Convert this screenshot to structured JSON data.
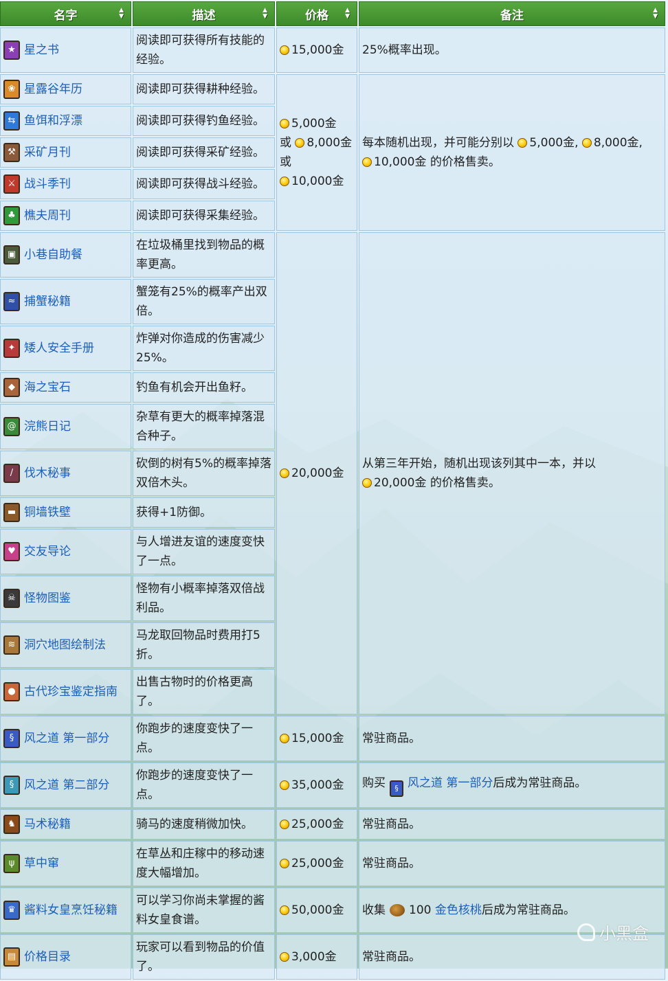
{
  "headers": [
    "名字",
    "描述",
    "价格",
    "备注"
  ],
  "colors": {
    "header_green": "#3f8d2f",
    "link_blue": "#1d5fb8",
    "coin_gold": "#ffd31a"
  },
  "rows": [
    {
      "name": "星之书",
      "icon": "book-star-icon",
      "color": "#8b3fb5",
      "glyph": "★",
      "desc": "阅读即可获得所有技能的经验。",
      "price": "15,000金",
      "note": "25%概率出现。"
    },
    {
      "name": "星露谷年历",
      "icon": "book-almanac-icon",
      "color": "#d98a2a",
      "glyph": "❀",
      "desc": "阅读即可获得耕种经验。"
    },
    {
      "name": "鱼饵和浮漂",
      "icon": "book-bait-icon",
      "color": "#2f7ad9",
      "glyph": "⇆",
      "desc": "阅读即可获得钓鱼经验。"
    },
    {
      "name": "采矿月刊",
      "icon": "book-mining-icon",
      "color": "#8a5a3a",
      "glyph": "⚒",
      "desc": "阅读即可获得采矿经验。"
    },
    {
      "name": "战斗季刊",
      "icon": "book-combat-icon",
      "color": "#c0392b",
      "glyph": "⚔",
      "desc": "阅读即可获得战斗经验。"
    },
    {
      "name": "樵夫周刊",
      "icon": "book-woodcutter-icon",
      "color": "#2e9a3a",
      "glyph": "♣",
      "desc": "阅读即可获得采集经验。"
    },
    {
      "name": "小巷自助餐",
      "icon": "book-trash-icon",
      "color": "#4a5a3a",
      "glyph": "▣",
      "desc": "在垃圾桶里找到物品的概率更高。"
    },
    {
      "name": "捕蟹秘籍",
      "icon": "book-crab-icon",
      "color": "#3050a8",
      "glyph": "≈",
      "desc": "蟹笼有25%的概率产出双倍。"
    },
    {
      "name": "矮人安全手册",
      "icon": "book-dwarf-icon",
      "color": "#b83a3a",
      "glyph": "✦",
      "desc": "炸弹对你造成的伤害减少25%。"
    },
    {
      "name": "海之宝石",
      "icon": "book-jewels-icon",
      "color": "#a8643a",
      "glyph": "◆",
      "desc": "钓鱼有机会开出鱼籽。"
    },
    {
      "name": "浣熊日记",
      "icon": "book-raccoon-icon",
      "color": "#3a8a3a",
      "glyph": "@",
      "desc": "杂草有更大的概率掉落混合种子。"
    },
    {
      "name": "伐木秘事",
      "icon": "book-lumber-icon",
      "color": "#7a3a4a",
      "glyph": "/",
      "desc": "砍倒的树有5%的概率掉落双倍木头。"
    },
    {
      "name": "铜墙铁壁",
      "icon": "book-defense-icon",
      "color": "#8a5a2a",
      "glyph": "▬",
      "desc": "获得+1防御。"
    },
    {
      "name": "交友导论",
      "icon": "book-friendship-icon",
      "color": "#c8408a",
      "glyph": "♥",
      "desc": "与人增进友谊的速度变快了一点。"
    },
    {
      "name": "怪物图鉴",
      "icon": "book-monster-icon",
      "color": "#3a3a3a",
      "glyph": "☠",
      "desc": "怪物有小概率掉落双倍战利品。"
    },
    {
      "name": "洞穴地图绘制法",
      "icon": "book-map-icon",
      "color": "#a8783a",
      "glyph": "≋",
      "desc": "马龙取回物品时费用打5折。"
    },
    {
      "name": "古代珍宝鉴定指南",
      "icon": "book-artifact-icon",
      "color": "#c8683a",
      "glyph": "●",
      "desc": "出售古物时的价格更高了。"
    },
    {
      "name": "风之道 第一部分",
      "icon": "book-wind1-icon",
      "color": "#3a5ac8",
      "glyph": "§",
      "desc": "你跑步的速度变快了一点。",
      "price": "15,000金",
      "note": "常驻商品。"
    },
    {
      "name": "风之道 第二部分",
      "icon": "book-wind2-icon",
      "color": "#3a9ab8",
      "glyph": "§",
      "desc": "你跑步的速度变快了一点。",
      "price": "35,000金",
      "note_parts": {
        "before": "购买",
        "link": "风之道 第一部分",
        "after": "后成为常驻商品。"
      }
    },
    {
      "name": "马术秘籍",
      "icon": "book-horse-icon",
      "color": "#8a4a1a",
      "glyph": "♞",
      "desc": "骑马的速度稍微加快。",
      "price": "25,000金",
      "note": "常驻商品。"
    },
    {
      "name": "草中窜",
      "icon": "book-grass-icon",
      "color": "#5a8a2a",
      "glyph": "ψ",
      "desc": "在草丛和庄稼中的移动速度大幅增加。",
      "price": "25,000金",
      "note": "常驻商品。"
    },
    {
      "name": "酱料女皇烹饪秘籍",
      "icon": "book-queen-icon",
      "color": "#3a6ac8",
      "glyph": "♛",
      "desc": "可以学习你尚未掌握的酱料女皇食谱。",
      "price": "50,000金",
      "note_parts": {
        "before": "收集",
        "count": "100",
        "link": "金色核桃",
        "after": "后成为常驻商品。"
      }
    },
    {
      "name": "价格目录",
      "icon": "book-catalogue-icon",
      "color": "#c8883a",
      "glyph": "▤",
      "desc": "玩家可以看到物品的价值了。",
      "price": "3,000金",
      "note": "常驻商品。"
    }
  ],
  "group1": {
    "price1": "5,000金",
    "or1": "或",
    "price2": "8,000金",
    "or2": "或",
    "price3": "10,000金",
    "note_a": "每本随机出现，并可能分别以",
    "price_a": "5,000金,",
    "price_b": "8,000金,",
    "price_c": "10,000金",
    "note_b": "的价格售卖。"
  },
  "group2": {
    "price": "20,000金",
    "note_a": "从第三年开始，随机出现该列其中一本，并以",
    "note_price": "20,000金",
    "note_b": "的价格售卖。"
  },
  "watermark": "小黑盒"
}
